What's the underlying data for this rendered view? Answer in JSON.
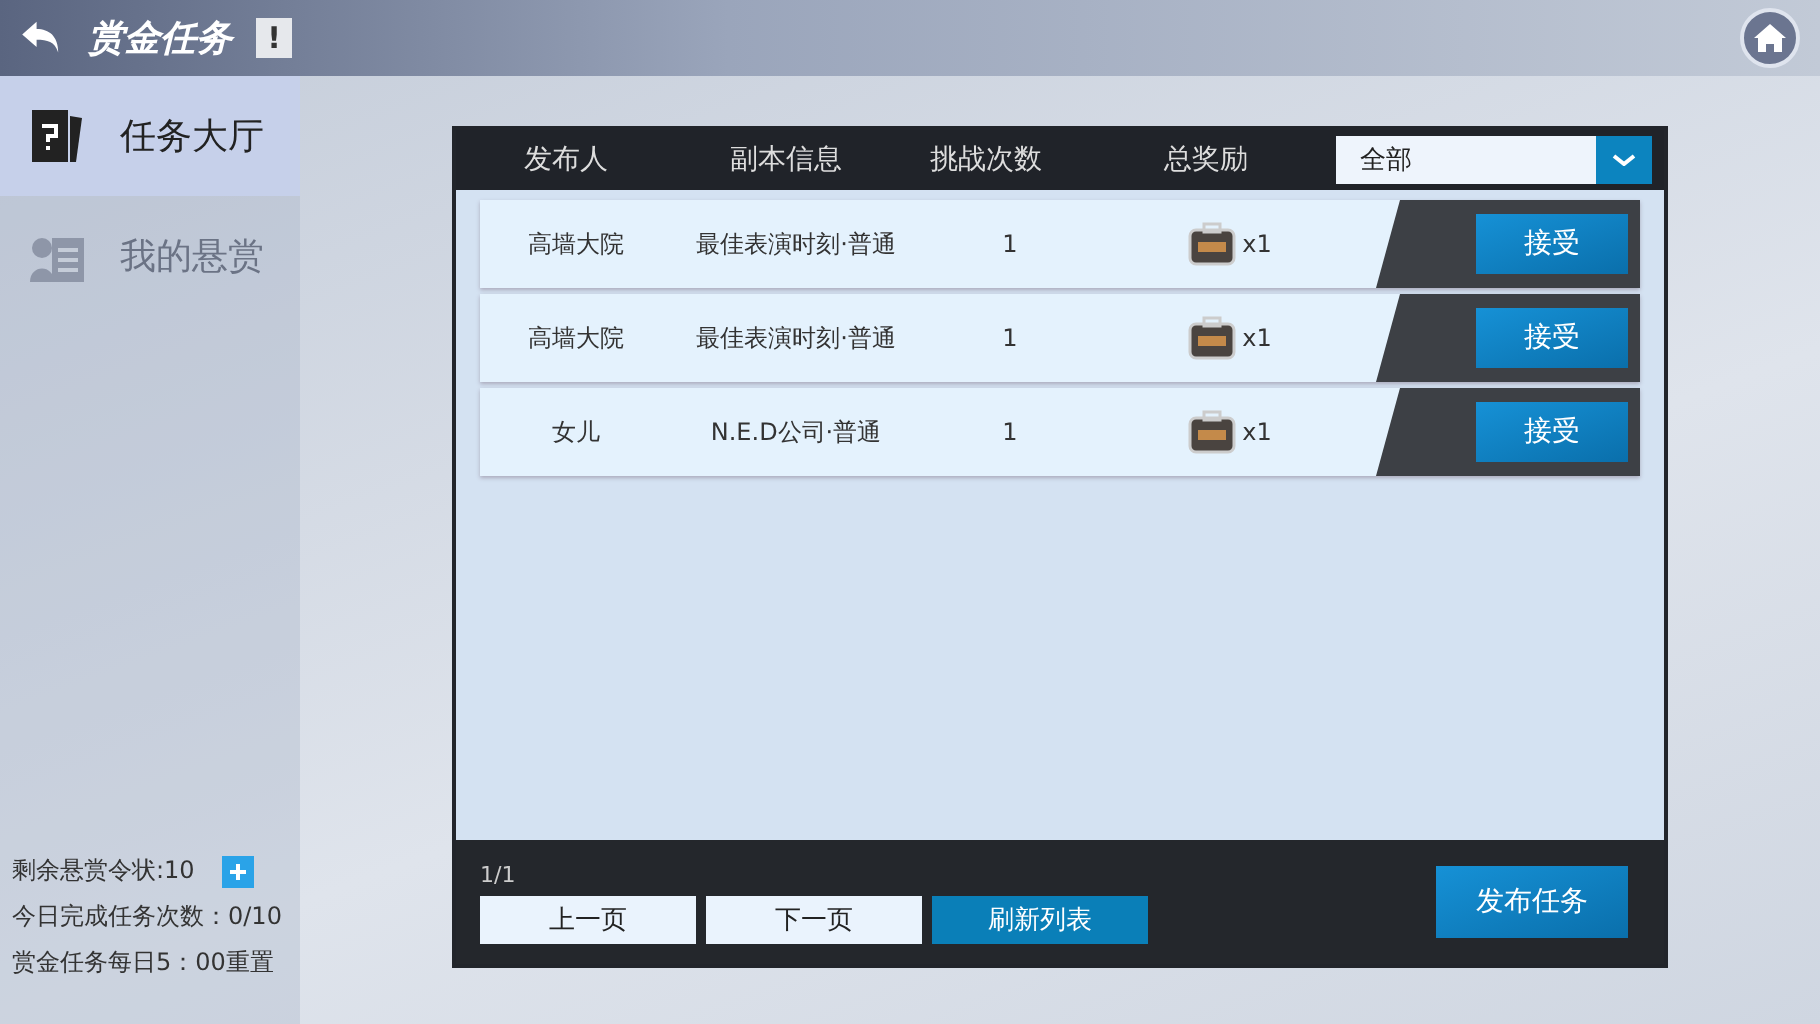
{
  "header": {
    "title": "赏金任务",
    "info_mark": "!"
  },
  "sidebar": {
    "items": [
      {
        "label": "任务大厅",
        "selected": true,
        "kind": "hall"
      },
      {
        "label": "我的悬赏",
        "selected": false,
        "kind": "mine"
      }
    ]
  },
  "stats": [
    {
      "text": "剩余悬赏令状:10",
      "has_add": true
    },
    {
      "text": "今日完成任务次数：0/10",
      "has_add": false
    },
    {
      "text": "赏金任务每日5：00重置",
      "has_add": false
    }
  ],
  "table": {
    "columns": [
      "发布人",
      "副本信息",
      "挑战次数",
      "总奖励"
    ],
    "filter": {
      "value": "全部"
    },
    "rows": [
      {
        "publisher": "高墙大院",
        "dungeon": "最佳表演时刻·普通",
        "attempts": "1",
        "reward": "x1",
        "action": "接受"
      },
      {
        "publisher": "高墙大院",
        "dungeon": "最佳表演时刻·普通",
        "attempts": "1",
        "reward": "x1",
        "action": "接受"
      },
      {
        "publisher": "女儿",
        "dungeon": "N.E.D公司·普通",
        "attempts": "1",
        "reward": "x1",
        "action": "接受"
      }
    ]
  },
  "footer": {
    "page": "1/1",
    "buttons": [
      {
        "label": "上一页",
        "kind": "plain"
      },
      {
        "label": "下一页",
        "kind": "plain"
      },
      {
        "label": "刷新列表",
        "kind": "primary"
      }
    ],
    "publish": "发布任务"
  }
}
